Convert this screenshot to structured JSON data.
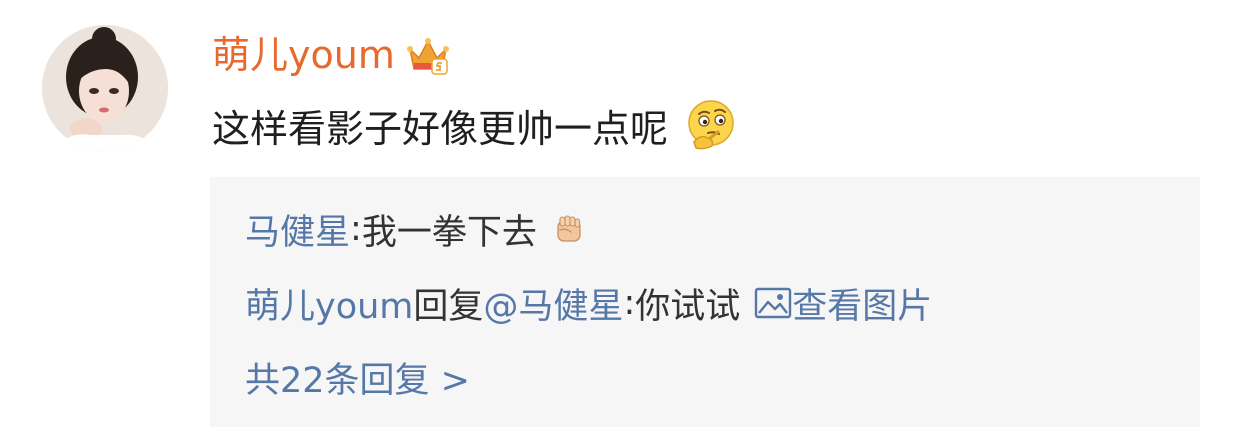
{
  "comment": {
    "username": "萌儿youm",
    "vip_badge_icon": "vip-crown-icon",
    "text": "这样看影子好像更帅一点呢",
    "emoji_icon": "thinking-face-icon"
  },
  "replies": {
    "reply1": {
      "author": "马健星",
      "separator": ": ",
      "text": "我一拳下去",
      "emoji_icon": "fist-icon"
    },
    "reply2": {
      "author": "萌儿youm",
      "verb": " 回复 ",
      "mention": "@马健星",
      "separator": ":",
      "text": "你试试",
      "view_image_icon": "image-icon",
      "view_image_label": "查看图片"
    },
    "more_replies_label": "共22条回复 >"
  },
  "colors": {
    "username": "#e8692d",
    "link": "#5678a8",
    "reply_background": "#f6f6f6",
    "text": "#1f1f1f"
  }
}
